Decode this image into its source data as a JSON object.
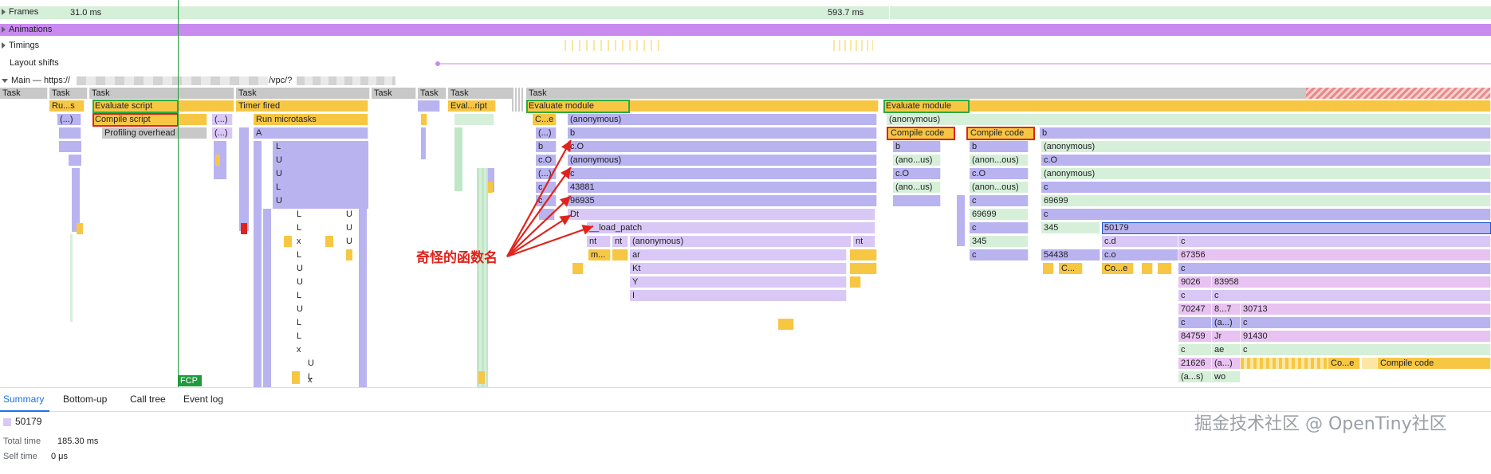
{
  "tracks": {
    "frames": {
      "label": "Frames",
      "time_left": "31.0 ms",
      "time_right": "593.7 ms"
    },
    "animations": {
      "label": "Animations"
    },
    "timings": {
      "label": "Timings"
    },
    "layout_shifts": {
      "label": "Layout shifts"
    },
    "main": {
      "label": "Main — https://",
      "url_tail": "/vpc/?"
    }
  },
  "tasks": [
    "Task",
    "Task",
    "Task",
    "Task",
    "Task",
    "Task",
    "Task",
    "Task"
  ],
  "blocks": {
    "ru_s": "Ru...s",
    "evaluate_script": "Evaluate script",
    "timer_fired": "Timer fired",
    "eval_ript": "Eval...ript",
    "evaluate_module_1": "Evaluate module",
    "evaluate_module_2": "Evaluate module",
    "paren1": "(...)",
    "compile_script": "Compile script",
    "paren2": "(...)",
    "run_microtasks": "Run microtasks",
    "ce": "C...e",
    "anon1": "(anonymous)",
    "anon2": "(anonymous)",
    "profiling_overhead": "Profiling overhead",
    "paren3": "(...)",
    "a_func": "A",
    "paren4": "(...)",
    "b1": "b",
    "compile_code_1": "Compile code",
    "compile_code_2": "Compile code",
    "b2": "b",
    "b_small": "b",
    "co1": "c.O",
    "b3": "b",
    "b4": "b",
    "anon3": "(anonymous)",
    "co_small": "c.O",
    "anon4": "(anonymous)",
    "anous1": "(ano...us)",
    "anous2": "(anon...ous)",
    "co2": "c.O",
    "paren5": "(...)",
    "c1": "c",
    "co3": "c.O",
    "co4": "c.O",
    "anon5": "(anonymous)",
    "c_small1": "c",
    "n43881": "43881",
    "anous3": "(ano...us)",
    "anous4": "(anon...ous)",
    "c2": "c",
    "c_small2": "c",
    "n96935": "96935",
    "c3": "c",
    "c4": "c",
    "n69699a": "69699",
    "dt": "Dt",
    "n69699b": "69699",
    "c5": "c",
    "load_patch": "__load_patch",
    "c6": "c",
    "n345a": "345",
    "n50179": "50179",
    "nt1": "nt",
    "nt2": "nt",
    "anon6": "(anonymous)",
    "nt3": "nt",
    "n345b": "345",
    "cd": "c.d",
    "c7": "c",
    "m": "m...",
    "ar": "ar",
    "c8": "c",
    "n54438": "54438",
    "co5": "c.o",
    "n67356": "67356",
    "kt": "Kt",
    "c_e1": "C...",
    "co_e": "Co...e",
    "c9": "c",
    "y": "Y",
    "n9026": "9026",
    "n83958": "83958",
    "i": "I",
    "c10": "c",
    "c11": "c",
    "n70247": "70247",
    "n8_7": "8...7",
    "n30713": "30713",
    "c12": "c",
    "a_dots1": "(a...)",
    "c13": "c",
    "n84759": "84759",
    "jr": "Jr",
    "n91430": "91430",
    "c14": "c",
    "ae": "ae",
    "c15": "c",
    "n21626": "21626",
    "a_dots2": "(a...)",
    "co_e2": "Co...e",
    "compile_code_3": "Compile code",
    "a_s": "(a...s)",
    "wo": "wo"
  },
  "column_letters": [
    "L",
    "U",
    "U",
    "L",
    "U",
    "L",
    "U",
    "L",
    "U",
    "x",
    "U",
    "L",
    "U",
    "U",
    "L",
    "U",
    "L",
    "L",
    "x",
    "U",
    "L",
    "x"
  ],
  "annotation": {
    "text": "奇怪的函数名",
    "color": "#e0231c"
  },
  "fcp_marker": "FCP",
  "tabs": {
    "summary": "Summary",
    "bottom_up": "Bottom-up",
    "call_tree": "Call tree",
    "event_log": "Event log"
  },
  "summary": {
    "name": "50179",
    "total_time_label": "Total time",
    "total_time_value": "185.30 ms",
    "self_time_label": "Self time",
    "self_time_value": "0 μs"
  },
  "watermark": "掘金技术社区 @ OpenTiny社区",
  "colors": {
    "frames": "#d6efd9",
    "animations": "#c98af0",
    "task": "#c8c8c8",
    "script": "#f7c744",
    "function": "#b9b3f0",
    "fcp": "#1e9c3c",
    "highlight_green": "#2eaa3f",
    "highlight_red": "#e0231c",
    "tab_active": "#1a73e8"
  }
}
